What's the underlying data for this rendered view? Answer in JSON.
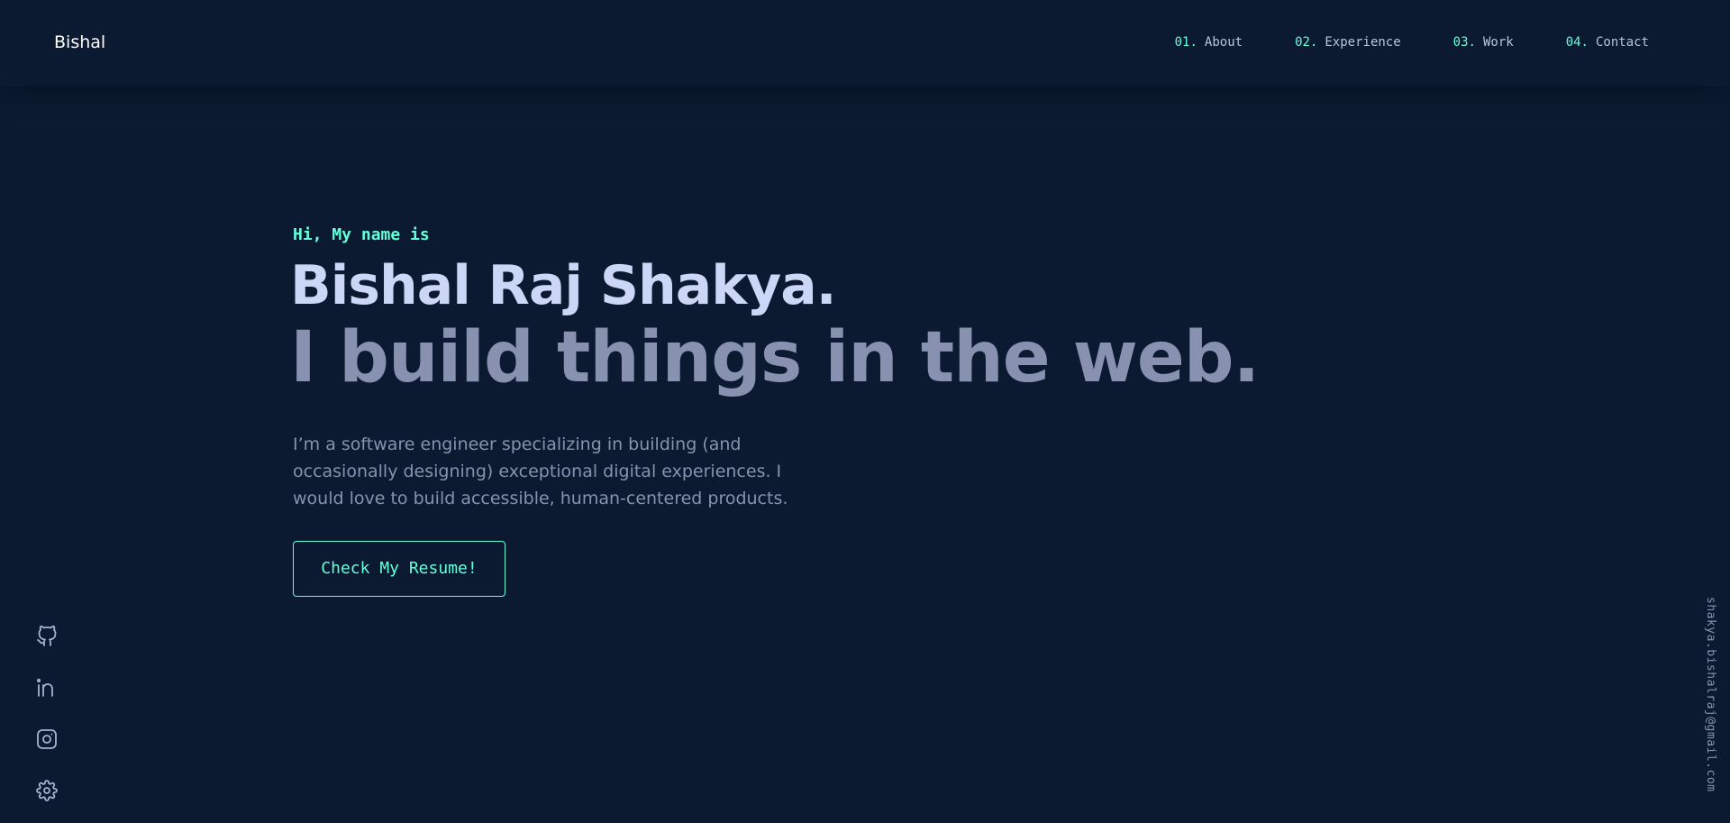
{
  "header": {
    "logo": "Bishal",
    "nav": [
      {
        "num": "01.",
        "label": "About"
      },
      {
        "num": "02.",
        "label": "Experience"
      },
      {
        "num": "03.",
        "label": "Work"
      },
      {
        "num": "04.",
        "label": "Contact"
      }
    ]
  },
  "hero": {
    "greeting": "Hi, My name is",
    "name": "Bishal Raj Shakya.",
    "tagline": "I build things in the web.",
    "intro": "I’m a software engineer specializing in building (and occasionally designing) exceptional digital experiences. I would love to build accessible, human-centered products.",
    "resume_label": "Check My Resume!"
  },
  "social": {
    "icons": [
      "github-icon",
      "linkedin-icon",
      "instagram-icon",
      "gear-icon"
    ]
  },
  "email": "shakya.bishalraj@gmail.com",
  "colors": {
    "background": "#0b1a30",
    "accent": "#64ffda",
    "heading": "#ccd6f6",
    "text": "#8892b0"
  }
}
